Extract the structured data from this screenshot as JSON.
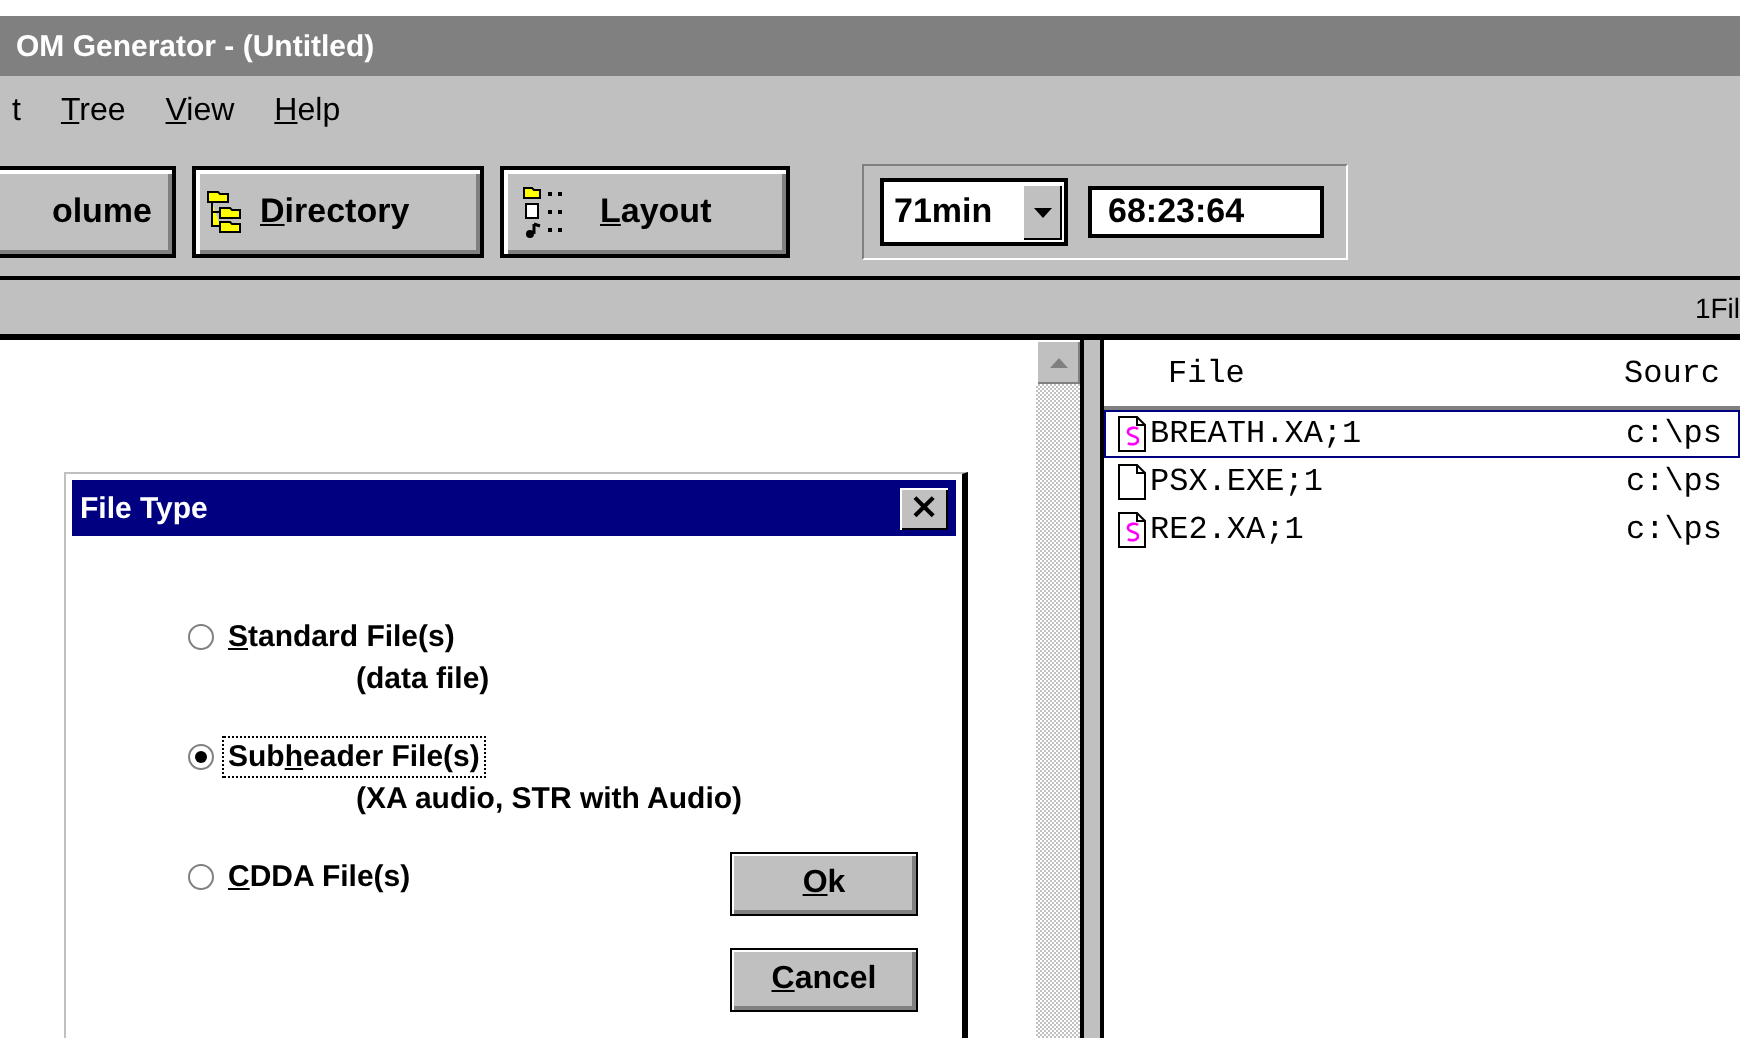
{
  "window": {
    "title": "OM Generator - (Untitled)"
  },
  "menu": [
    {
      "before": "t"
    },
    {
      "key": "T",
      "after": "ree"
    },
    {
      "key": "V",
      "after": "iew"
    },
    {
      "key": "H",
      "after": "elp"
    }
  ],
  "toolbar": {
    "buttons": [
      {
        "kind": "volume",
        "after": "olume"
      },
      {
        "kind": "directory",
        "key": "D",
        "after": "irectory"
      },
      {
        "kind": "layout",
        "key": "L",
        "after": "ayout"
      }
    ],
    "capacity": {
      "value": "71min"
    },
    "time": {
      "value": "68:23:64"
    }
  },
  "status_bar": {
    "text": "1Fil"
  },
  "file_list": {
    "columns": [
      "File",
      "Sourc"
    ],
    "rows": [
      {
        "kind": "xa",
        "name": "BREATH.XA;1",
        "source": "c:\\ps",
        "selected": true
      },
      {
        "kind": "plain",
        "name": "PSX.EXE;1",
        "source": "c:\\ps",
        "selected": false
      },
      {
        "kind": "xa",
        "name": "RE2.XA;1",
        "source": "c:\\ps",
        "selected": false
      }
    ]
  },
  "dialog": {
    "title": "File Type",
    "close": "×",
    "options": [
      {
        "key": "S",
        "after": "tandard File(s)",
        "note": "(data file)",
        "selected": false,
        "focused": false
      },
      {
        "before": "Sub",
        "key": "h",
        "after": "eader File(s)",
        "note": "(XA audio, STR with Audio)",
        "selected": true,
        "focused": true
      },
      {
        "key": "C",
        "after": "DDA File(s)",
        "selected": false,
        "focused": false
      }
    ],
    "buttons": [
      {
        "key": "O",
        "after": "k"
      },
      {
        "key": "C",
        "after": "ancel"
      }
    ]
  }
}
